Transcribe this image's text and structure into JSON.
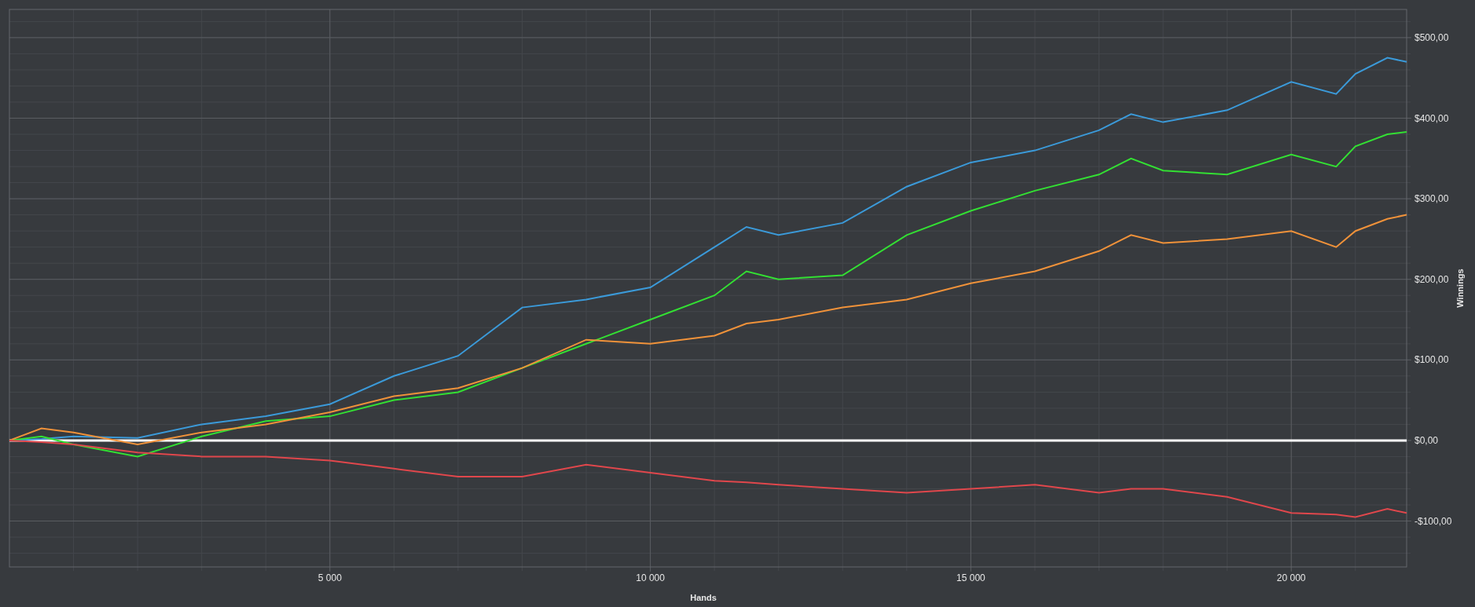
{
  "chart_data": {
    "type": "line",
    "grid": true,
    "xlabel": "Hands",
    "ylabel": "Winnings",
    "x": [
      0,
      500,
      1000,
      2000,
      3000,
      4000,
      5000,
      6000,
      7000,
      8000,
      9000,
      10000,
      11000,
      11500,
      12000,
      13000,
      14000,
      15000,
      16000,
      17000,
      17500,
      18000,
      19000,
      20000,
      20700,
      21000,
      21500,
      21800
    ],
    "series": [
      {
        "color": "#3b9ad9",
        "values": [
          0,
          2,
          5,
          3,
          20,
          30,
          45,
          80,
          105,
          165,
          175,
          190,
          240,
          265,
          255,
          270,
          315,
          345,
          360,
          385,
          405,
          395,
          410,
          445,
          430,
          455,
          475,
          470
        ]
      },
      {
        "color": "#33e033",
        "values": [
          0,
          5,
          -5,
          -20,
          5,
          24,
          30,
          50,
          60,
          90,
          120,
          150,
          180,
          210,
          200,
          205,
          255,
          285,
          310,
          330,
          350,
          335,
          330,
          355,
          340,
          365,
          380,
          383
        ]
      },
      {
        "color": "#f0923a",
        "values": [
          0,
          15,
          10,
          -5,
          10,
          20,
          35,
          55,
          65,
          90,
          125,
          120,
          130,
          145,
          150,
          165,
          175,
          195,
          210,
          235,
          255,
          245,
          250,
          260,
          240,
          260,
          275,
          280
        ]
      },
      {
        "color": "#e0474c",
        "values": [
          0,
          -2,
          -5,
          -15,
          -20,
          -20,
          -25,
          -35,
          -45,
          -45,
          -30,
          -40,
          -50,
          -52,
          -55,
          -60,
          -65,
          -60,
          -55,
          -65,
          -60,
          -60,
          -70,
          -90,
          -92,
          -95,
          -85,
          -90
        ]
      }
    ],
    "xlim": [
      0,
      21800
    ],
    "ylim": [
      -157,
      535
    ],
    "xticks": [
      {
        "value": 5000,
        "label": "5 000"
      },
      {
        "value": 10000,
        "label": "10 000"
      },
      {
        "value": 15000,
        "label": "15 000"
      },
      {
        "value": 20000,
        "label": "20 000"
      }
    ],
    "yticks": [
      {
        "value": 500,
        "label": "$500,00"
      },
      {
        "value": 400,
        "label": "$400,00"
      },
      {
        "value": 300,
        "label": "$300,00"
      },
      {
        "value": 200,
        "label": "$200,00"
      },
      {
        "value": 100,
        "label": "$100,00"
      },
      {
        "value": 0,
        "label": "$0,00"
      },
      {
        "value": -100,
        "label": "-$100,00"
      }
    ]
  }
}
